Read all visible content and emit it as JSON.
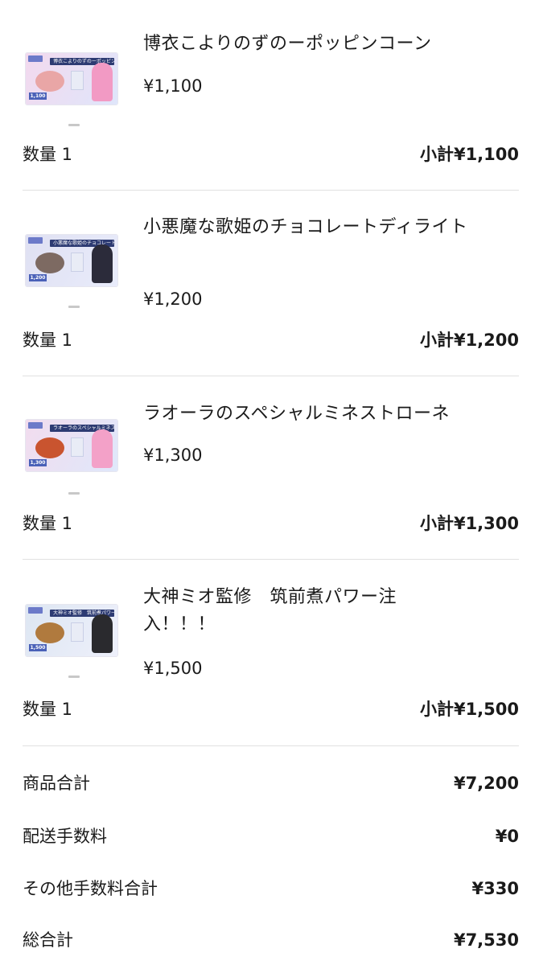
{
  "items": [
    {
      "name": "博衣こよりのずのーポッピンコーン",
      "price": "¥1,100",
      "quantity": "数量 1",
      "subtotal": "小計¥1,100",
      "thumb_banner": "博衣こよりのずのーポッピンコーン",
      "thumb_price": "1,100",
      "thumb_colors": {
        "bg": "#f3d9ee",
        "food": "#e9a6a6",
        "chara": "#f29ac4"
      }
    },
    {
      "name": "小悪魔な歌姫のチョコレートディライト",
      "price": "¥1,200",
      "quantity": "数量 1",
      "subtotal": "小計¥1,200",
      "thumb_banner": "小悪魔な歌姫のチョコレートディライト",
      "thumb_price": "1,200",
      "thumb_colors": {
        "bg": "#dfe0f2",
        "food": "#7d6a62",
        "chara": "#2b2b3a"
      }
    },
    {
      "name": "ラオーラのスペシャルミネストローネ",
      "price": "¥1,300",
      "quantity": "数量 1",
      "subtotal": "小計¥1,300",
      "thumb_banner": "ラオーラのスペシャルミネストローネ",
      "thumb_price": "1,300",
      "thumb_colors": {
        "bg": "#f2dcee",
        "food": "#c9542f",
        "chara": "#f3a1c8"
      }
    },
    {
      "name": "大神ミオ監修　筑前煮パワー注入！！！",
      "price": "¥1,500",
      "quantity": "数量 1",
      "subtotal": "小計¥1,500",
      "thumb_banner": "大神ミオ監修　筑前煮パワー注入！！！",
      "thumb_price": "1,500",
      "thumb_colors": {
        "bg": "#dde6f2",
        "food": "#b07a3e",
        "chara": "#2a2a2e"
      }
    }
  ],
  "summary": {
    "product_total_label": "商品合計",
    "product_total_value": "¥7,200",
    "shipping_label": "配送手数料",
    "shipping_value": "¥0",
    "other_fees_label": "その他手数料合計",
    "other_fees_value": "¥330",
    "grand_total_label": "総合計",
    "grand_total_value": "¥7,530"
  }
}
